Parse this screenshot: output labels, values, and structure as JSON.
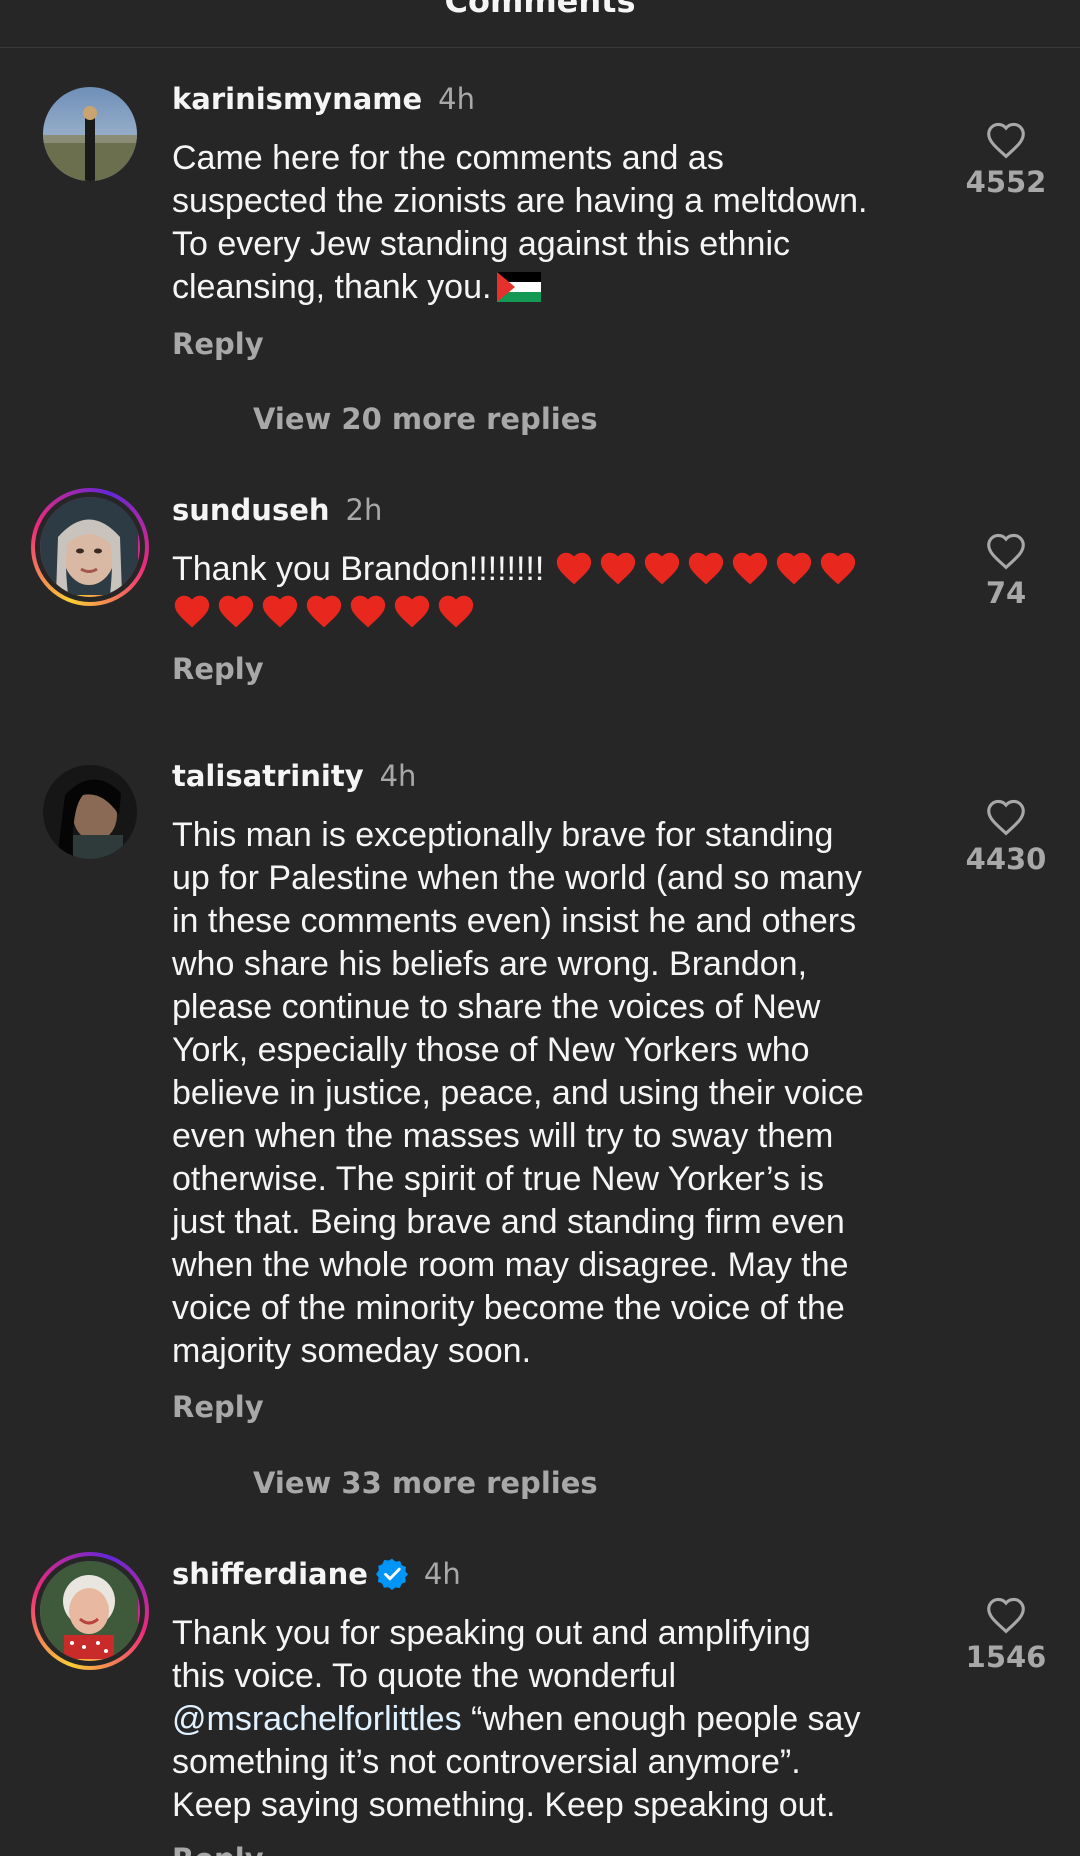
{
  "header": {
    "title": "Comments"
  },
  "comments": [
    {
      "username": "karinismyname",
      "time": "4h",
      "text_lines": [
        "Came here for the comments and as",
        "suspected the zionists are having a meltdown.",
        "To every Jew standing against this ethnic",
        "cleansing, thank you."
      ],
      "reply_label": "Reply",
      "likes": "4552",
      "view_replies": "View 20 more replies"
    },
    {
      "username": "sunduseh",
      "time": "2h",
      "text_lines": [
        "Thank you Brandon!!!!!!!!"
      ],
      "heart_emoji": "❤️",
      "reply_label": "Reply",
      "likes": "74"
    },
    {
      "username": "talisatrinity",
      "time": "4h",
      "text_lines": [
        "This man is exceptionally brave for standing",
        "up for Palestine when the world (and so many",
        "in these comments even) insist he and others",
        "who share his beliefs are wrong. Brandon,",
        "please continue to share the voices of New",
        "York, especially those of New Yorkers who",
        "believe in justice, peace, and using their voice",
        "even when the masses will try to sway them",
        "otherwise. The spirit of true New Yorker’s is",
        "just that. Being brave and standing firm even",
        "when the whole room may disagree. May the",
        "voice of the minority become the voice of the",
        "majority someday soon."
      ],
      "reply_label": "Reply",
      "likes": "4430",
      "view_replies": "View 33 more replies"
    },
    {
      "username": "shifferdiane",
      "time": "4h",
      "text_lines": [
        "Thank you for speaking out and amplifying",
        "this voice. To quote the wonderful",
        "“when enough people say",
        "something it’s not controversial anymore”.",
        "Keep saying something. Keep speaking out."
      ],
      "mention": "@msrachelforlittles",
      "reply_label": "Reply",
      "likes": "1546"
    }
  ],
  "colors": {
    "background": "#262626",
    "text": "#f5f5f5",
    "secondary_text": "#a8a8a8",
    "mention": "#e0f1ff",
    "verified": "#0095f6"
  },
  "icons": [
    "heart-outline-icon",
    "verified-badge-icon",
    "palestine-flag-emoji",
    "red-heart-emoji"
  ]
}
